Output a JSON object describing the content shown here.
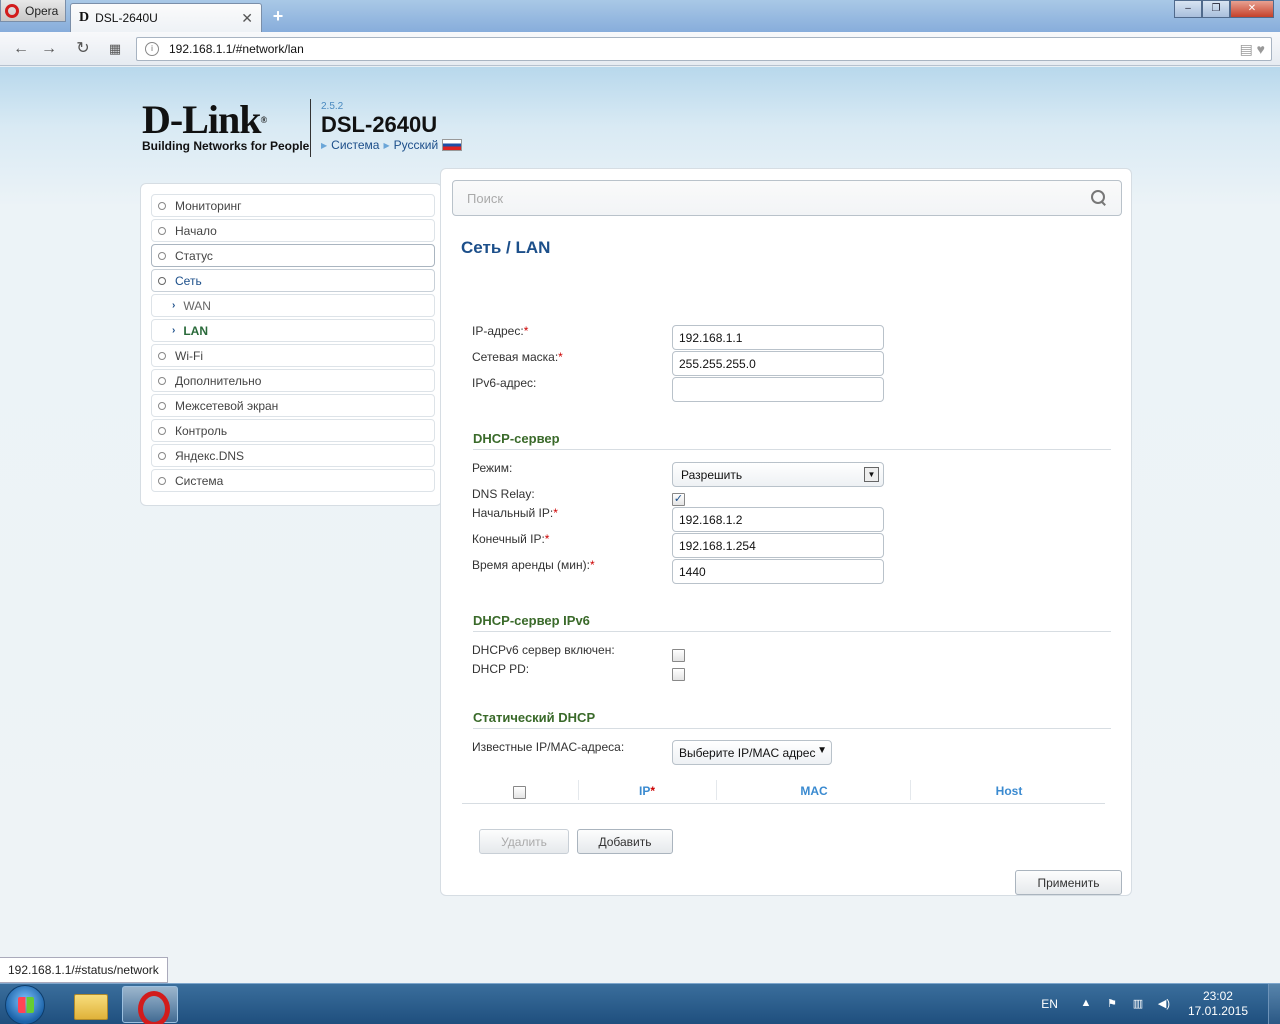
{
  "browser": {
    "menu_label": "Opera",
    "tab_title": "DSL-2640U",
    "tab_favicon": "D",
    "url": "192.168.1.1/#network/lan",
    "status_url": "192.168.1.1/#status/network"
  },
  "header": {
    "brand": "D-Link",
    "brand_mark": "®",
    "tagline": "Building Networks for People",
    "firmware_version": "2.5.2",
    "model": "DSL-2640U",
    "system_link": "Система",
    "language_link": "Русский"
  },
  "sidebar": {
    "items": [
      {
        "label": "Мониторинг"
      },
      {
        "label": "Начало"
      },
      {
        "label": "Статус"
      },
      {
        "label": "Сеть"
      },
      {
        "label": "WAN"
      },
      {
        "label": "LAN"
      },
      {
        "label": "Wi-Fi"
      },
      {
        "label": "Дополнительно"
      },
      {
        "label": "Межсетевой экран"
      },
      {
        "label": "Контроль"
      },
      {
        "label": "Яндекс.DNS"
      },
      {
        "label": "Система"
      }
    ]
  },
  "main": {
    "search_placeholder": "Поиск",
    "breadcrumb_parent": "Сеть /",
    "breadcrumb_current": "LAN",
    "ip": {
      "label": "IP-адрес:",
      "value": "192.168.1.1"
    },
    "mask": {
      "label": "Сетевая маска:",
      "value": "255.255.255.0"
    },
    "ipv6": {
      "label": "IPv6-адрес:",
      "value": ""
    },
    "dhcp": {
      "title": "DHCP-сервер",
      "mode_label": "Режим:",
      "mode_value": "Разрешить",
      "relay_label": "DNS Relay:",
      "relay_checked": true,
      "start_label": "Начальный IP:",
      "start_value": "192.168.1.2",
      "end_label": "Конечный IP:",
      "end_value": "192.168.1.254",
      "lease_label": "Время аренды (мин):",
      "lease_value": "1440"
    },
    "dhcp6": {
      "title": "DHCP-сервер IPv6",
      "enabled_label": "DHCPv6 сервер включен:",
      "pd_label": "DHCP PD:"
    },
    "static": {
      "title": "Статический DHCP",
      "known_label": "Известные IP/MAC-адреса:",
      "known_value": "Выберите IP/MAC адрес",
      "col_ip": "IP",
      "col_ip_required": "*",
      "col_mac": "MAC",
      "col_host": "Host"
    },
    "required_mark": "*",
    "delete_label": "Удалить",
    "add_label": "Добавить",
    "apply_label": "Применить"
  },
  "taskbar": {
    "lang": "EN",
    "time": "23:02",
    "date": "17.01.2015"
  }
}
